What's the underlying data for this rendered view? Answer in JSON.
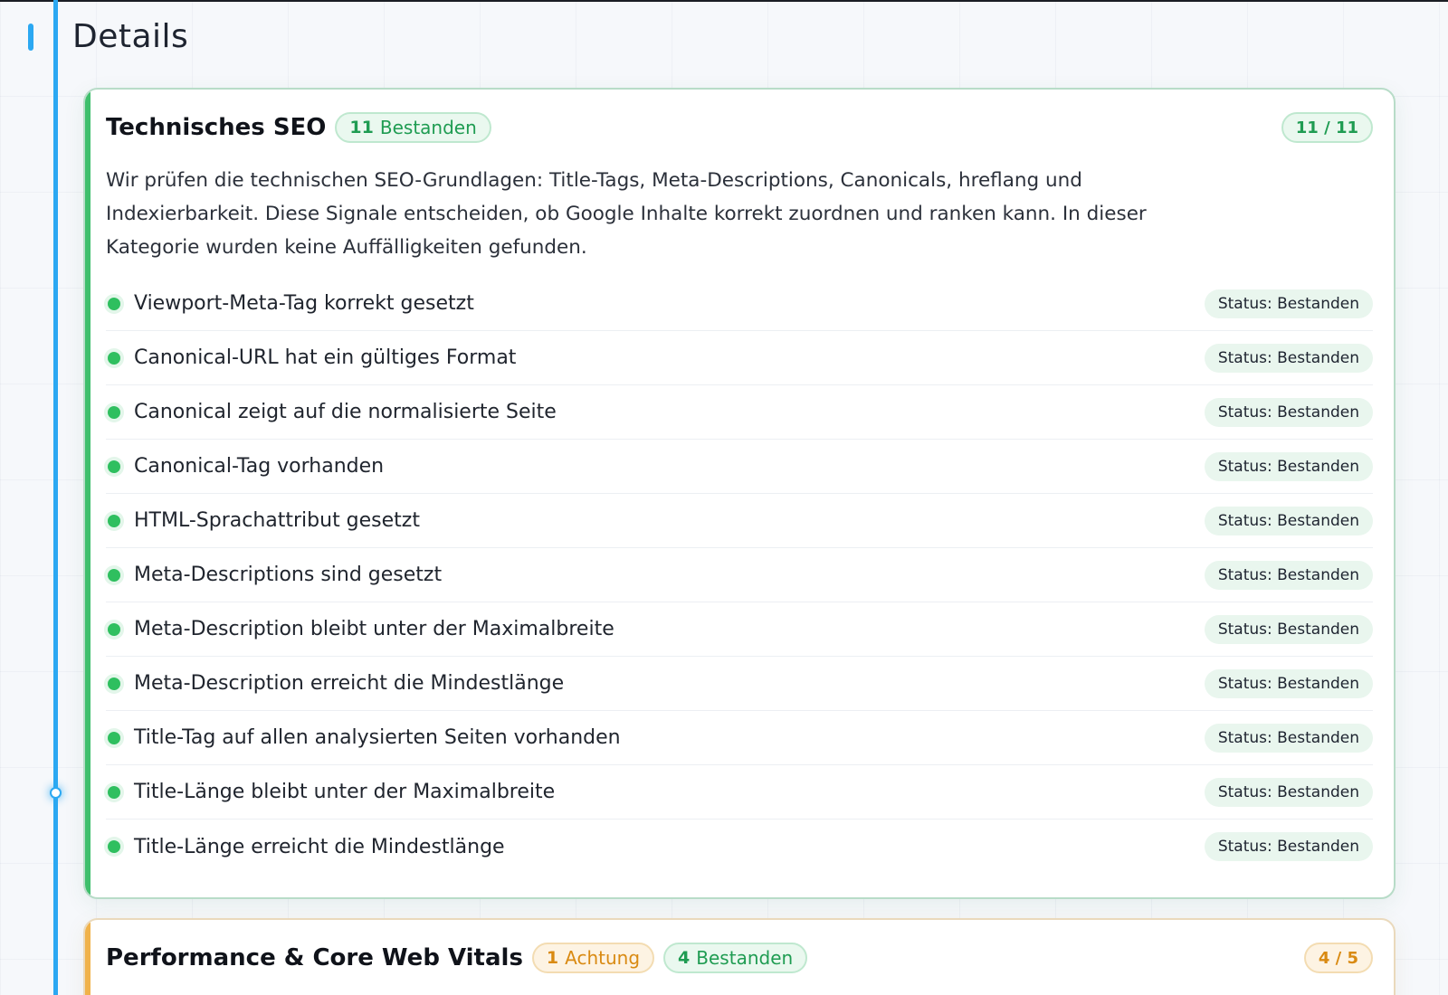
{
  "page": {
    "title": "Details"
  },
  "sections": [
    {
      "title": "Technisches SEO",
      "badges": [
        {
          "count": "11",
          "label": "Bestanden",
          "tone": "green"
        }
      ],
      "score": "11 / 11",
      "accent_color": "#3fbf6c",
      "description": "Wir prüfen die technischen SEO-Grundlagen: Title-Tags, Meta-Descriptions, Canonicals, hreflang und Indexierbarkeit. Diese Signale entscheiden, ob Google Inhalte korrekt zuordnen und ranken kann. In dieser Kategorie wurden keine Auffälligkeiten gefunden.",
      "checks": [
        {
          "label": "Viewport-Meta-Tag korrekt gesetzt",
          "status": "Status: Bestanden"
        },
        {
          "label": "Canonical-URL hat ein gültiges Format",
          "status": "Status: Bestanden"
        },
        {
          "label": "Canonical zeigt auf die normalisierte Seite",
          "status": "Status: Bestanden"
        },
        {
          "label": "Canonical-Tag vorhanden",
          "status": "Status: Bestanden"
        },
        {
          "label": "HTML-Sprachattribut gesetzt",
          "status": "Status: Bestanden"
        },
        {
          "label": "Meta-Descriptions sind gesetzt",
          "status": "Status: Bestanden"
        },
        {
          "label": "Meta-Description bleibt unter der Maximalbreite",
          "status": "Status: Bestanden"
        },
        {
          "label": "Meta-Description erreicht die Mindestlänge",
          "status": "Status: Bestanden"
        },
        {
          "label": "Title-Tag auf allen analysierten Seiten vorhanden",
          "status": "Status: Bestanden"
        },
        {
          "label": "Title-Länge bleibt unter der Maximalbreite",
          "status": "Status: Bestanden"
        },
        {
          "label": "Title-Länge erreicht die Mindestlänge",
          "status": "Status: Bestanden"
        }
      ]
    },
    {
      "title": "Performance & Core Web Vitals",
      "badges": [
        {
          "count": "1",
          "label": "Achtung",
          "tone": "orange"
        },
        {
          "count": "4",
          "label": "Bestanden",
          "tone": "green"
        }
      ],
      "score": "4 / 5",
      "accent_color": "#f0b24a"
    }
  ],
  "colors": {
    "timeline": "#2ba8f2",
    "pass": "#2fbf5f",
    "warning": "#d98a12"
  }
}
